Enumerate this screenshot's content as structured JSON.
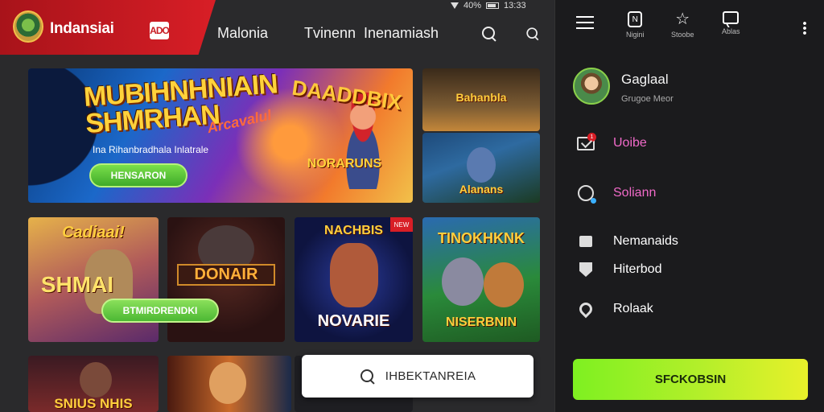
{
  "brand": {
    "name": "Indansiai",
    "badge": "ADO"
  },
  "status_bar": {
    "signal": "40%",
    "time": "13:33"
  },
  "nav": {
    "links": [
      "Malonia",
      "Tvinenn",
      "Inenamiash"
    ]
  },
  "hero": {
    "title": "MUBIHNHNIAIN SHMRHAN",
    "script": "Arcavalul",
    "tagline": "Ina Rihanbradhala Inlatrale",
    "button": "HENSARON",
    "game_title": "DAADDBIX",
    "game_subtitle": "NORARUNS"
  },
  "side_cards": [
    {
      "title": "Bahanbla"
    },
    {
      "title": "Alanans"
    }
  ],
  "games": [
    {
      "title": "Cadiaai!",
      "subtitle": "SHMAI"
    },
    {
      "title": "DONAIR"
    },
    {
      "title": "NACHBIS",
      "subtitle": "NOVARIE",
      "badge": "NEW"
    },
    {
      "title": "TINOKHKNK",
      "subtitle": "NISERBNIN"
    }
  ],
  "play_button": "BTMIRDRENDKI",
  "bottom_cards": [
    {
      "title": "SNIUS NHIS"
    },
    {
      "title": ""
    },
    {
      "title": ""
    }
  ],
  "search_pill": {
    "text": "IHBEKTANREIA"
  },
  "panel": {
    "top_items": [
      {
        "label": "",
        "icon": "menu-icon"
      },
      {
        "label": "Nigini",
        "icon": "box-icon"
      },
      {
        "label": "Stoobe",
        "icon": "star-icon"
      },
      {
        "label": "Ablas",
        "icon": "chat-icon"
      }
    ],
    "profile": {
      "name": "Gaglaal",
      "sub": "Grugoe Meor"
    },
    "menu": [
      {
        "label": "Uoibe",
        "color": "#f06ac8",
        "icon": "inbox-icon",
        "badge": "1"
      },
      {
        "label": "Soliann",
        "color": "#f06ac8",
        "icon": "search-icon"
      },
      {
        "label": "Nemanaids",
        "color": "#f2f2f2",
        "icon": "square-icon"
      },
      {
        "label": "Hiterbod",
        "color": "#f2f2f2",
        "icon": "shield-icon"
      },
      {
        "label": "Rolaak",
        "color": "#f2f2f2",
        "icon": "pin-icon"
      }
    ],
    "cta": "SFCKOBSIN"
  },
  "colors": {
    "brand_red": "#d81e26",
    "accent_green": "#7ef021",
    "accent_pink": "#f06ac8"
  }
}
